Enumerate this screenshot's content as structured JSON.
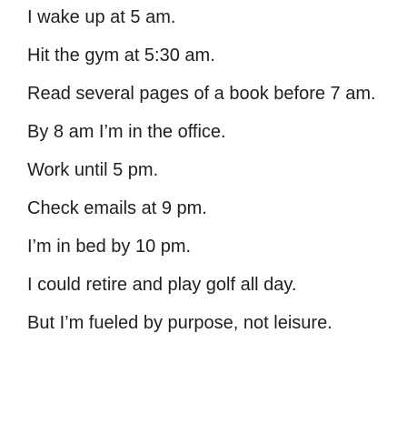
{
  "post": {
    "lines": [
      "I wake up at 5 am.",
      "Hit the gym at 5:30 am.",
      "Read several pages of a book before 7 am.",
      "By 8 am I’m in the office.",
      "Work until 5 pm.",
      "Check emails at 9 pm.",
      "I’m in bed by 10 pm.",
      "I could retire and play golf all day.",
      "But I’m fueled by purpose, not leisure."
    ],
    "text_color": "#1f1f1f",
    "background_color": "#ffffff"
  }
}
